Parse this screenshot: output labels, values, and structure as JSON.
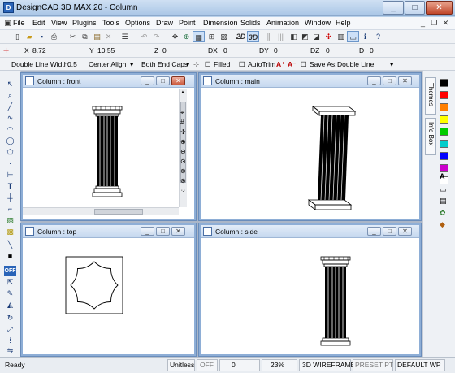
{
  "window": {
    "title": "DesignCAD 3D MAX 20 - Column",
    "app_icon": "designcad-app-icon",
    "controls": [
      "minimize",
      "maximize",
      "close"
    ]
  },
  "menu": {
    "items": [
      "File",
      "Edit",
      "View",
      "Plugins",
      "Tools",
      "Options",
      "Draw",
      "Point",
      "Dimension",
      "Solids",
      "Animation",
      "Window",
      "Help"
    ]
  },
  "toolbar": {
    "btn_2d": "2D",
    "btn_3d": "3D"
  },
  "coords": {
    "x_label": "X",
    "x_value": "8.72",
    "y_label": "Y",
    "y_value": "10.55",
    "z_label": "Z",
    "z_value": "0",
    "dx_label": "DX",
    "dx_value": "0",
    "dy_label": "DY",
    "dy_value": "0",
    "dz_label": "DZ",
    "dz_value": "0",
    "d_label": "D",
    "d_value": "0"
  },
  "linebar": {
    "line_width_label": "Double Line Width:",
    "line_width_value": "0.5",
    "align": "Center Align",
    "caps": "Both End Caps",
    "filled": "Filled",
    "autotrim": "AutoTrim",
    "save_as_label": "Save As:",
    "save_as_value": "Double Line"
  },
  "views": {
    "front": "Column : front",
    "main": "Column : main",
    "top": "Column : top",
    "side": "Column : side"
  },
  "right_panel": {
    "tab_themes": "Themes",
    "tab_info": "Info Box",
    "colors": [
      "#000000",
      "#ff0000",
      "#ff7f00",
      "#ffff00",
      "#00cc00",
      "#00cccc",
      "#0000ff",
      "#cc00cc",
      "#ffffff"
    ]
  },
  "status": {
    "ready": "Ready",
    "unitless": "Unitless",
    "off": "OFF",
    "count": "0",
    "zoom": "23%",
    "render_mode": "3D WIREFRAME",
    "preset": "PRESET PT",
    "wp": "DEFAULT WP"
  }
}
